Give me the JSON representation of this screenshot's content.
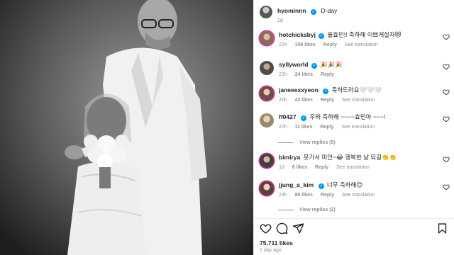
{
  "post": {
    "username": "hyominnn",
    "caption": "D-day",
    "time": "1d",
    "likes": "75,711 likes",
    "ago": "1 day ago"
  },
  "comments": [
    {
      "username": "hotchicksbyj",
      "text": "율효민!! 축하해 이쁘게살자😻",
      "time": "22h",
      "likes": "158 likes",
      "reply": "Reply",
      "translation": "See translation"
    },
    {
      "username": "syllyworld",
      "text": "🎉🎉🎉",
      "time": "22h",
      "likes": "24 likes",
      "reply": "Reply"
    },
    {
      "username": "janeeexxyeon",
      "text": "축하드려요🤍🤍🤍",
      "time": "20h",
      "likes": "42 likes",
      "reply": "Reply",
      "translation": "See translation"
    },
    {
      "username": "ff0427",
      "text": "우와 축하해 ~~~~효민아 ~~~!",
      "time": "22h",
      "likes": "11 likes",
      "reply": "Reply",
      "translation": "See translation",
      "view_replies": "View replies (5)"
    },
    {
      "username": "bimirya",
      "text": "못가서 미안~😂 행복한 날 되길👏👏",
      "time": "1d",
      "likes": "6 likes",
      "reply": "Reply",
      "translation": "See translation"
    },
    {
      "username": "jjung_a_kim",
      "text": "너무 축하해😊",
      "time": "23h",
      "likes": "88 likes",
      "reply": "Reply",
      "translation": "See translation",
      "view_replies": "View replies (2)"
    }
  ],
  "icons": {
    "like": "heart-icon",
    "comment": "comment-icon",
    "share": "share-icon",
    "save": "bookmark-icon"
  },
  "colors": {
    "verified": "#0095f6",
    "muted": "#8e8e8e",
    "text": "#262626"
  }
}
